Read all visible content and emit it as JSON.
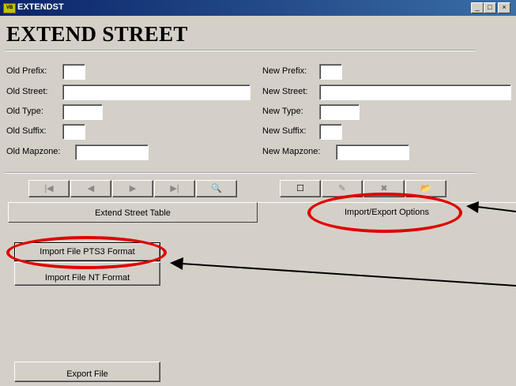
{
  "window": {
    "title": "EXTENDST",
    "icon_text": "VB",
    "min": "_",
    "max": "□",
    "close": "×"
  },
  "header": {
    "title": "EXTEND STREET"
  },
  "old": {
    "prefix_label": "Old Prefix:",
    "street_label": "Old Street:",
    "type_label": "Old Type:",
    "suffix_label": "Old Suffix:",
    "mapzone_label": "Old Mapzone:"
  },
  "new": {
    "prefix_label": "New Prefix:",
    "street_label": "New Street:",
    "type_label": "New Type:",
    "suffix_label": "New Suffix:",
    "mapzone_label": "New Mapzone:"
  },
  "nav": {
    "first": "|◀",
    "prev": "◀",
    "next": "▶",
    "last": "▶|",
    "find": "🔍"
  },
  "edit": {
    "new": "☐",
    "edit": "✎",
    "delete": "✖",
    "open": "📂"
  },
  "tabs": [
    {
      "label": "Extend Street Table"
    },
    {
      "label": "Import/Export Options"
    }
  ],
  "actions": {
    "import_pts3": "Import File PTS3 Format",
    "import_nt": "Import File NT Format",
    "export": "Export File"
  },
  "highlight_color": "#e00000"
}
